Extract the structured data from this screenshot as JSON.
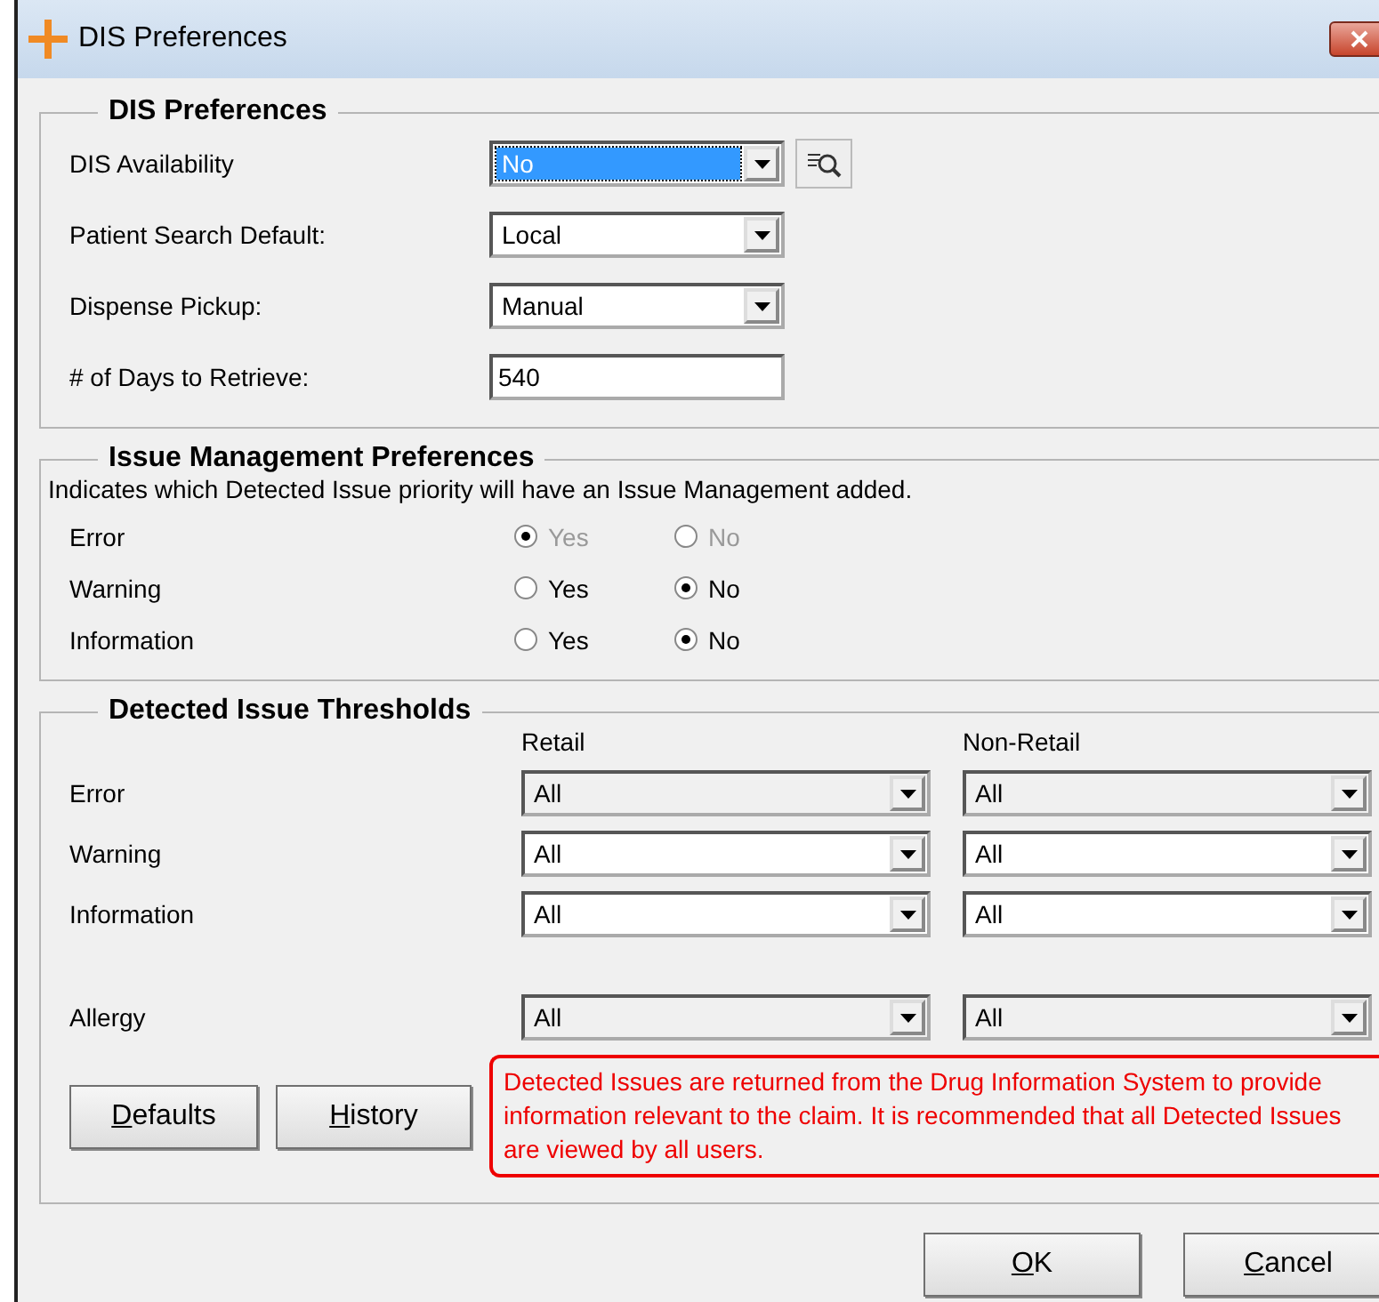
{
  "window": {
    "title": "DIS Preferences"
  },
  "dis_preferences": {
    "title": "DIS Preferences",
    "fields": [
      {
        "label": "DIS Availability",
        "kind": "combo",
        "value": "No",
        "focused": true
      },
      {
        "label": "Patient Search Default:",
        "kind": "combo",
        "value": "Local"
      },
      {
        "label": "Dispense Pickup:",
        "kind": "combo",
        "value": "Manual"
      },
      {
        "label": "# of Days to Retrieve:",
        "kind": "text",
        "value": "540"
      }
    ]
  },
  "issue_management": {
    "title": "Issue Management Preferences",
    "description": "Indicates which Detected Issue priority will have an Issue Management added.",
    "rows": [
      {
        "label": "Error",
        "disabled": true,
        "options": [
          {
            "label": "Yes",
            "selected": true
          },
          {
            "label": "No",
            "selected": false
          }
        ]
      },
      {
        "label": "Warning",
        "disabled": false,
        "options": [
          {
            "label": "Yes",
            "selected": false
          },
          {
            "label": "No",
            "selected": true
          }
        ]
      },
      {
        "label": "Information",
        "disabled": false,
        "options": [
          {
            "label": "Yes",
            "selected": false
          },
          {
            "label": "No",
            "selected": true
          }
        ]
      }
    ]
  },
  "thresholds": {
    "title": "Detected Issue Thresholds",
    "columns": [
      "Retail",
      "Non-Retail"
    ],
    "rows": [
      {
        "label": "Error",
        "values": [
          {
            "value": "All",
            "disabled": true
          },
          {
            "value": "All",
            "disabled": true
          }
        ]
      },
      {
        "label": "Warning",
        "values": [
          {
            "value": "All",
            "disabled": false
          },
          {
            "value": "All",
            "disabled": false
          }
        ]
      },
      {
        "label": "Information",
        "values": [
          {
            "value": "All",
            "disabled": false
          },
          {
            "value": "All",
            "disabled": false
          }
        ]
      },
      {
        "label": "Allergy",
        "values": [
          {
            "value": "All",
            "disabled": true
          },
          {
            "value": "All",
            "disabled": true
          }
        ]
      }
    ],
    "buttons": [
      "Defaults",
      "History"
    ],
    "note": "Detected Issues are returned from the Drug Information System to provide information relevant to the claim. It is recommended that all Detected Issues are viewed by all users."
  },
  "buttons": [
    "OK",
    "Cancel"
  ]
}
